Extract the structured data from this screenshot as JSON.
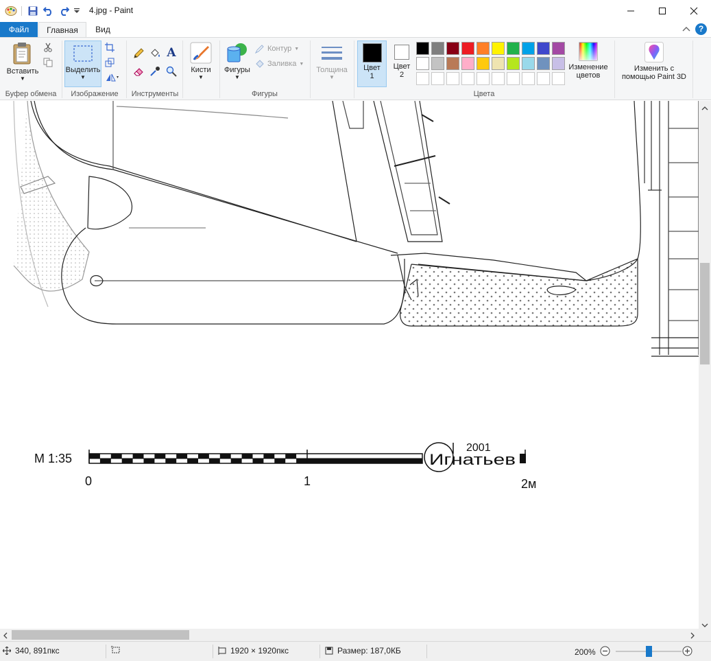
{
  "window": {
    "title": "4.jpg - Paint"
  },
  "tabs": {
    "file": "Файл",
    "home": "Главная",
    "view": "Вид"
  },
  "ribbon": {
    "clipboard": {
      "paste": "Вставить",
      "group": "Буфер обмена"
    },
    "image": {
      "select": "Выделить",
      "group": "Изображение"
    },
    "tools": {
      "group": "Инструменты"
    },
    "brushes": {
      "label": "Кисти"
    },
    "shapes": {
      "shapes": "Фигуры",
      "outline": "Контур",
      "fill": "Заливка",
      "group": "Фигуры"
    },
    "size": {
      "label": "Толщина"
    },
    "colors": {
      "color1_line1": "Цвет",
      "color1_line2": "1",
      "color2_line1": "Цвет",
      "color2_line2": "2",
      "edit_line1": "Изменение",
      "edit_line2": "цветов",
      "group": "Цвета",
      "color1_value": "#000000",
      "color2_value": "#ffffff",
      "palette_row1": [
        "#000000",
        "#7f7f7f",
        "#880015",
        "#ed1c24",
        "#ff7f27",
        "#fff200",
        "#22b14c",
        "#00a2e8",
        "#3f48cc",
        "#a349a4"
      ],
      "palette_row2": [
        "#ffffff",
        "#c3c3c3",
        "#b97a57",
        "#ffaec9",
        "#ffc90e",
        "#efe4b0",
        "#b5e61d",
        "#99d9ea",
        "#7092be",
        "#c8bfe7"
      ]
    },
    "paint3d": {
      "line1": "Изменить с",
      "line2": "помощью Paint 3D"
    }
  },
  "drawing": {
    "scale_label": "М 1:35",
    "tick_0": "0",
    "tick_1": "1",
    "tick_2": "2м",
    "author": "Игнатьев",
    "year": "2001"
  },
  "status": {
    "cursor": "340, 891пкс",
    "dimensions": "1920 × 1920пкс",
    "size": "Размер: 187,0КБ",
    "zoom": "200%",
    "zoom_fraction": 0.5
  }
}
